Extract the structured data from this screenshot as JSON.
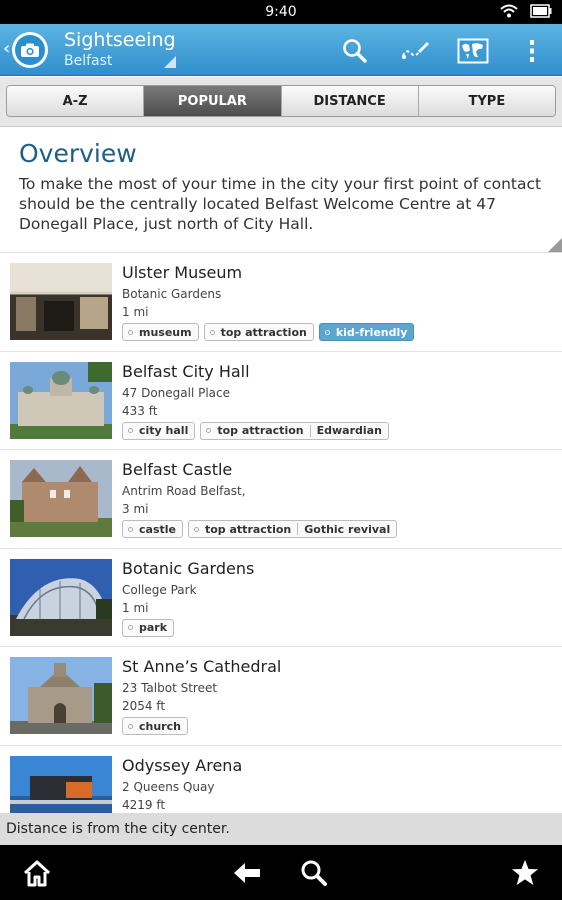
{
  "status_bar": {
    "time": "9:40"
  },
  "action_bar": {
    "title": "Sightseeing",
    "subtitle": "Belfast",
    "actions": [
      "search-icon",
      "route-icon",
      "map-icon",
      "overflow-menu-icon"
    ]
  },
  "tabs": [
    {
      "label": "A-Z"
    },
    {
      "label": "POPULAR"
    },
    {
      "label": "DISTANCE"
    },
    {
      "label": "TYPE"
    }
  ],
  "overview": {
    "title": "Overview",
    "text": "To make the most of your time in the city your first point of contact should be the centrally located Belfast Welcome Centre at 47 Donegall Place, just north of City Hall."
  },
  "places": [
    {
      "name": "Ulster Museum",
      "address": "Botanic Gardens",
      "distance": "1 mi",
      "tags": [
        "museum",
        "top attraction",
        "kid-friendly"
      ]
    },
    {
      "name": "Belfast City Hall",
      "address": "47 Donegall Place",
      "distance": "433 ft",
      "tags": [
        "city hall",
        "top attraction",
        "Edwardian"
      ]
    },
    {
      "name": "Belfast Castle",
      "address": "Antrim Road  Belfast,",
      "distance": "3 mi",
      "tags": [
        "castle",
        "top attraction",
        "Gothic revival"
      ]
    },
    {
      "name": "Botanic Gardens",
      "address": "College Park",
      "distance": "1 mi",
      "tags": [
        "park"
      ]
    },
    {
      "name": "St Anne’s Cathedral",
      "address": "23 Talbot Street",
      "distance": "2054 ft",
      "tags": [
        "church"
      ]
    },
    {
      "name": "Odyssey Arena",
      "address": "2 Queens Quay",
      "distance": "4219 ft",
      "tags": []
    }
  ],
  "footer_note": "Distance is from the city center.",
  "nav": [
    "home-icon",
    "back-arrow-icon",
    "search-icon",
    "favorites-star-icon"
  ],
  "colors": {
    "accent": "#2f8fcd",
    "title": "#1d5f87",
    "highlight_tag": "#5aa6cf"
  }
}
